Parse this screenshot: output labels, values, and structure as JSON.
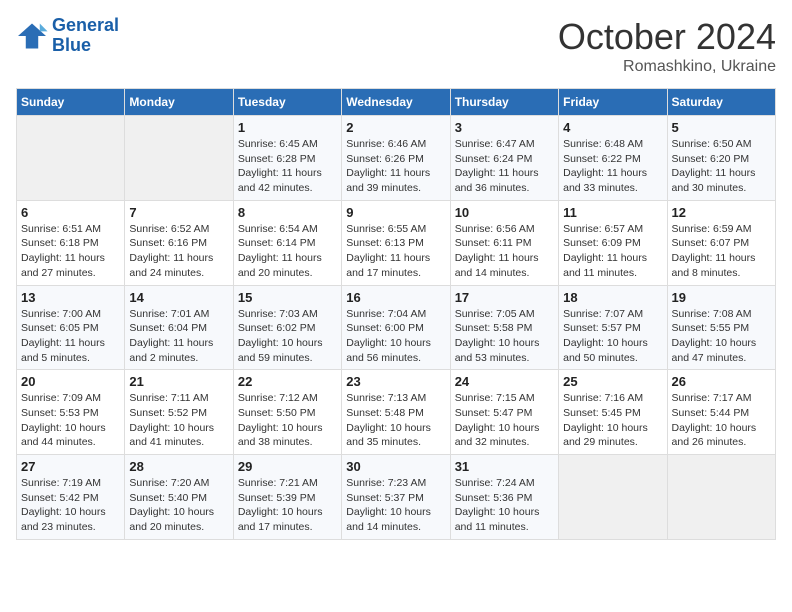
{
  "header": {
    "logo_line1": "General",
    "logo_line2": "Blue",
    "month": "October 2024",
    "location": "Romashkino, Ukraine"
  },
  "weekdays": [
    "Sunday",
    "Monday",
    "Tuesday",
    "Wednesday",
    "Thursday",
    "Friday",
    "Saturday"
  ],
  "weeks": [
    [
      {
        "day": "",
        "info": ""
      },
      {
        "day": "",
        "info": ""
      },
      {
        "day": "1",
        "info": "Sunrise: 6:45 AM\nSunset: 6:28 PM\nDaylight: 11 hours and 42 minutes."
      },
      {
        "day": "2",
        "info": "Sunrise: 6:46 AM\nSunset: 6:26 PM\nDaylight: 11 hours and 39 minutes."
      },
      {
        "day": "3",
        "info": "Sunrise: 6:47 AM\nSunset: 6:24 PM\nDaylight: 11 hours and 36 minutes."
      },
      {
        "day": "4",
        "info": "Sunrise: 6:48 AM\nSunset: 6:22 PM\nDaylight: 11 hours and 33 minutes."
      },
      {
        "day": "5",
        "info": "Sunrise: 6:50 AM\nSunset: 6:20 PM\nDaylight: 11 hours and 30 minutes."
      }
    ],
    [
      {
        "day": "6",
        "info": "Sunrise: 6:51 AM\nSunset: 6:18 PM\nDaylight: 11 hours and 27 minutes."
      },
      {
        "day": "7",
        "info": "Sunrise: 6:52 AM\nSunset: 6:16 PM\nDaylight: 11 hours and 24 minutes."
      },
      {
        "day": "8",
        "info": "Sunrise: 6:54 AM\nSunset: 6:14 PM\nDaylight: 11 hours and 20 minutes."
      },
      {
        "day": "9",
        "info": "Sunrise: 6:55 AM\nSunset: 6:13 PM\nDaylight: 11 hours and 17 minutes."
      },
      {
        "day": "10",
        "info": "Sunrise: 6:56 AM\nSunset: 6:11 PM\nDaylight: 11 hours and 14 minutes."
      },
      {
        "day": "11",
        "info": "Sunrise: 6:57 AM\nSunset: 6:09 PM\nDaylight: 11 hours and 11 minutes."
      },
      {
        "day": "12",
        "info": "Sunrise: 6:59 AM\nSunset: 6:07 PM\nDaylight: 11 hours and 8 minutes."
      }
    ],
    [
      {
        "day": "13",
        "info": "Sunrise: 7:00 AM\nSunset: 6:05 PM\nDaylight: 11 hours and 5 minutes."
      },
      {
        "day": "14",
        "info": "Sunrise: 7:01 AM\nSunset: 6:04 PM\nDaylight: 11 hours and 2 minutes."
      },
      {
        "day": "15",
        "info": "Sunrise: 7:03 AM\nSunset: 6:02 PM\nDaylight: 10 hours and 59 minutes."
      },
      {
        "day": "16",
        "info": "Sunrise: 7:04 AM\nSunset: 6:00 PM\nDaylight: 10 hours and 56 minutes."
      },
      {
        "day": "17",
        "info": "Sunrise: 7:05 AM\nSunset: 5:58 PM\nDaylight: 10 hours and 53 minutes."
      },
      {
        "day": "18",
        "info": "Sunrise: 7:07 AM\nSunset: 5:57 PM\nDaylight: 10 hours and 50 minutes."
      },
      {
        "day": "19",
        "info": "Sunrise: 7:08 AM\nSunset: 5:55 PM\nDaylight: 10 hours and 47 minutes."
      }
    ],
    [
      {
        "day": "20",
        "info": "Sunrise: 7:09 AM\nSunset: 5:53 PM\nDaylight: 10 hours and 44 minutes."
      },
      {
        "day": "21",
        "info": "Sunrise: 7:11 AM\nSunset: 5:52 PM\nDaylight: 10 hours and 41 minutes."
      },
      {
        "day": "22",
        "info": "Sunrise: 7:12 AM\nSunset: 5:50 PM\nDaylight: 10 hours and 38 minutes."
      },
      {
        "day": "23",
        "info": "Sunrise: 7:13 AM\nSunset: 5:48 PM\nDaylight: 10 hours and 35 minutes."
      },
      {
        "day": "24",
        "info": "Sunrise: 7:15 AM\nSunset: 5:47 PM\nDaylight: 10 hours and 32 minutes."
      },
      {
        "day": "25",
        "info": "Sunrise: 7:16 AM\nSunset: 5:45 PM\nDaylight: 10 hours and 29 minutes."
      },
      {
        "day": "26",
        "info": "Sunrise: 7:17 AM\nSunset: 5:44 PM\nDaylight: 10 hours and 26 minutes."
      }
    ],
    [
      {
        "day": "27",
        "info": "Sunrise: 7:19 AM\nSunset: 5:42 PM\nDaylight: 10 hours and 23 minutes."
      },
      {
        "day": "28",
        "info": "Sunrise: 7:20 AM\nSunset: 5:40 PM\nDaylight: 10 hours and 20 minutes."
      },
      {
        "day": "29",
        "info": "Sunrise: 7:21 AM\nSunset: 5:39 PM\nDaylight: 10 hours and 17 minutes."
      },
      {
        "day": "30",
        "info": "Sunrise: 7:23 AM\nSunset: 5:37 PM\nDaylight: 10 hours and 14 minutes."
      },
      {
        "day": "31",
        "info": "Sunrise: 7:24 AM\nSunset: 5:36 PM\nDaylight: 10 hours and 11 minutes."
      },
      {
        "day": "",
        "info": ""
      },
      {
        "day": "",
        "info": ""
      }
    ]
  ]
}
